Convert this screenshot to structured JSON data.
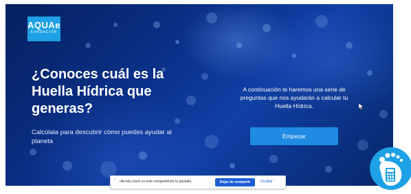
{
  "logo": {
    "line1": "AQUAe",
    "line2": "FUNDACIÓN"
  },
  "hero": {
    "headline": "¿Conoces cuál es la Huella Hídrica que generas?",
    "subtext": "Calcúlala para descubrir cómo puedes ayudar al planeta",
    "intro": "A continuación te haremos una serie de preguntas que nos ayudarán a calcular tu Huella Hídrica.",
    "start_button": "Empezar"
  },
  "share_bar": {
    "message": "ulb-edu.zoom.us está compartiendo tu pantalla.",
    "stop_button": "Dejar de compartir",
    "hide_link": "Ocultar"
  },
  "colors": {
    "accent": "#1f8be3",
    "logo_bg": "#1ea1e6",
    "share_button": "#1a5fd6"
  },
  "icons": {
    "cursor": "mouse-pointer-icon",
    "badge": "footprint-calculator-icon",
    "grip": "drag-grip-icon"
  }
}
